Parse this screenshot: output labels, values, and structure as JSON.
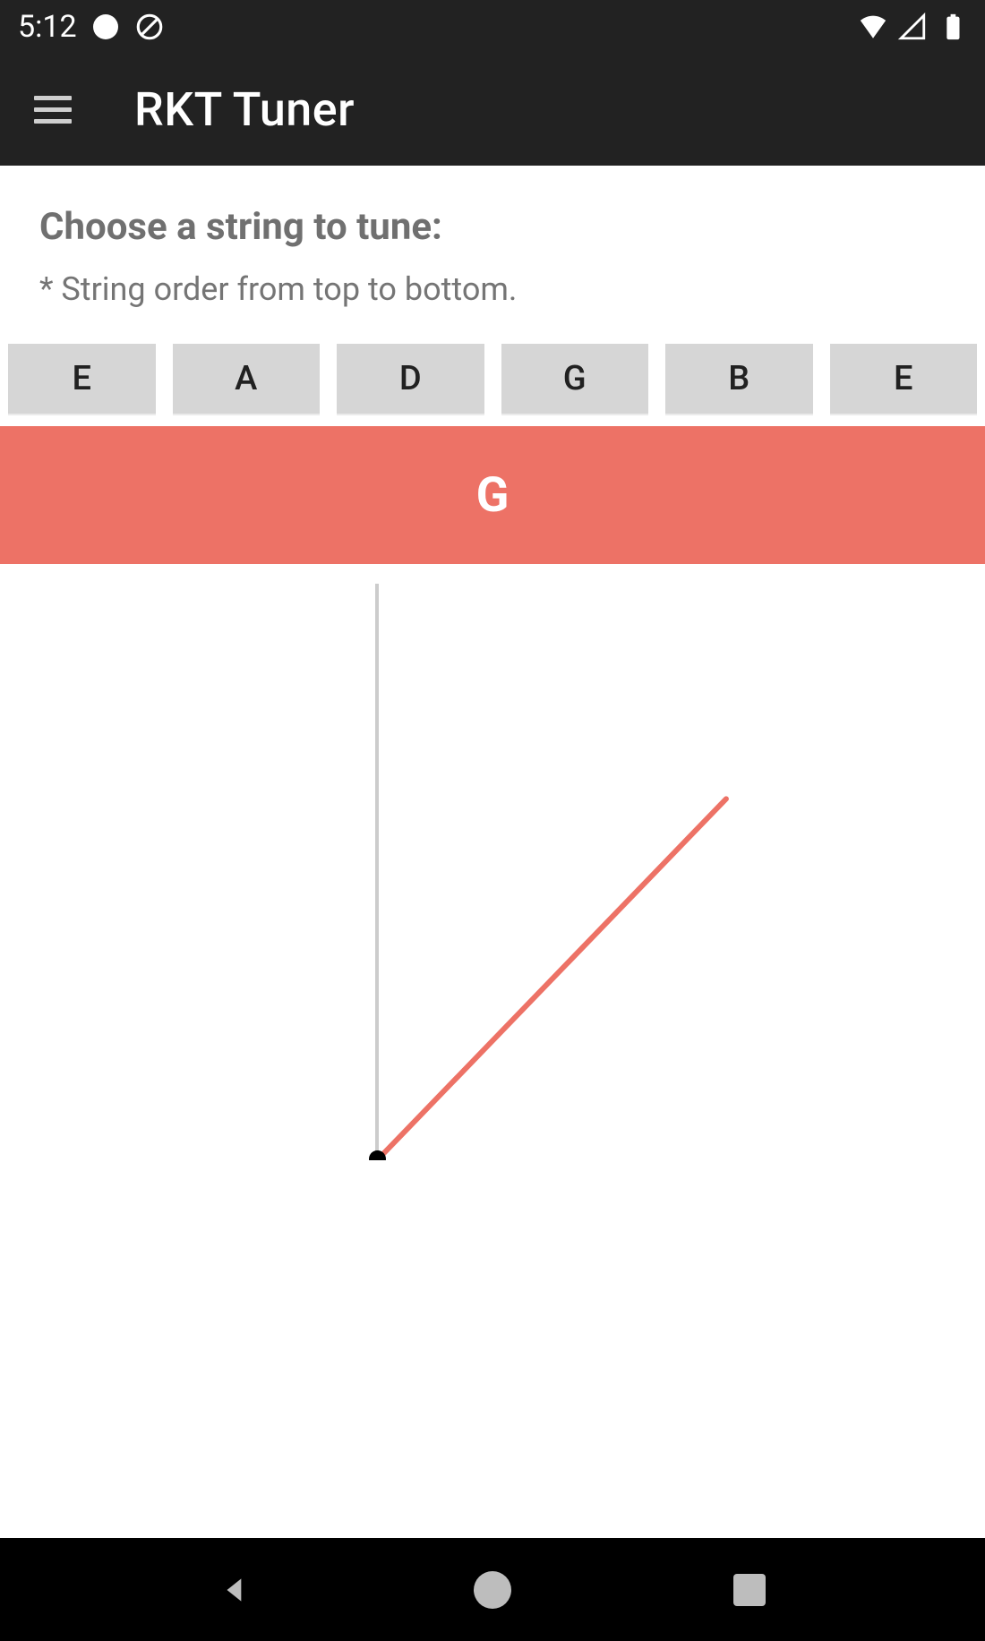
{
  "status": {
    "time": "5:12"
  },
  "app": {
    "title": "RKT Tuner"
  },
  "content": {
    "heading": "Choose a string to tune:",
    "sub": "* String order from top to bottom."
  },
  "strings": {
    "items": [
      "E",
      "A",
      "D",
      "G",
      "B",
      "E"
    ]
  },
  "selected": {
    "note": "G"
  },
  "gauge": {
    "needle_angle_deg": 44,
    "accent_color": "#ED7266"
  }
}
